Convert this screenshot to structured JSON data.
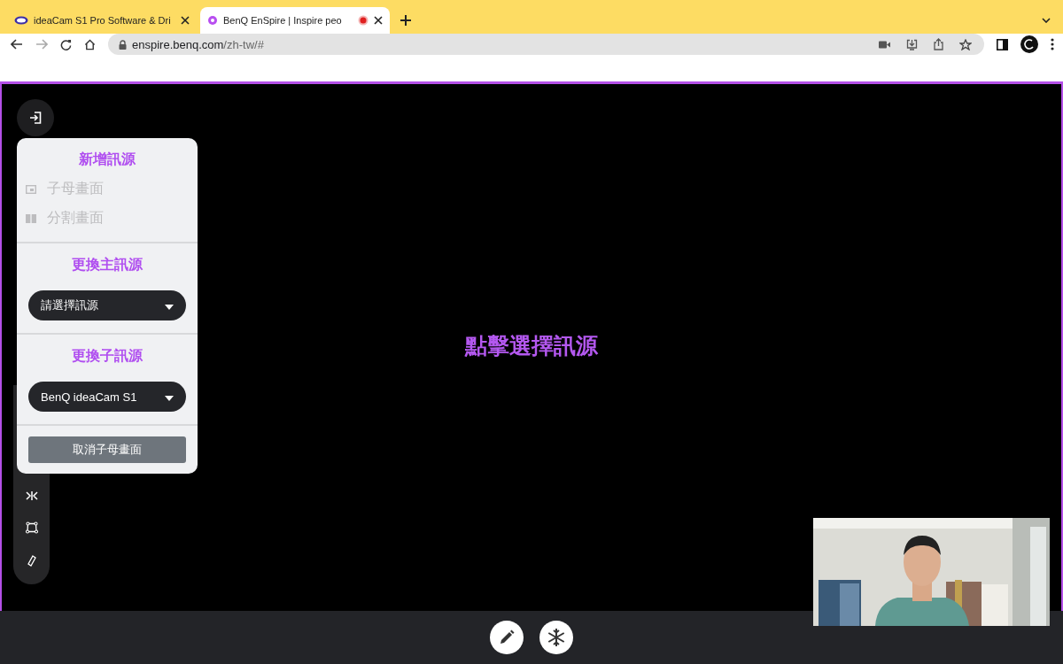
{
  "browser": {
    "tabs": [
      {
        "title": "ideaCam S1 Pro Software & Dri",
        "selected": false,
        "recording": false
      },
      {
        "title": "BenQ EnSpire | Inspire peo",
        "selected": true,
        "recording": true
      }
    ],
    "url_host": "enspire.benq.com",
    "url_path": "/zh-tw/#"
  },
  "panel": {
    "add_title": "新增訊源",
    "layouts": [
      {
        "label": "子母畫面",
        "kind": "pip",
        "disabled": true
      },
      {
        "label": "分割畫面",
        "kind": "split",
        "disabled": true
      }
    ],
    "main_title": "更換主訊源",
    "main_select": {
      "placeholder": "請選擇訊源"
    },
    "sub_title": "更換子訊源",
    "sub_select": {
      "value": "BenQ ideaCam S1"
    },
    "cancel_button": "取消子母畫面"
  },
  "stage": {
    "prompt": "點擊選擇訊源"
  }
}
